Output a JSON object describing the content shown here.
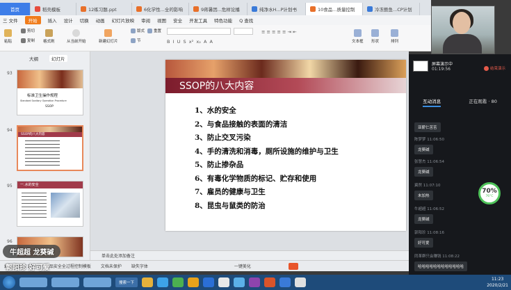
{
  "tabs": [
    {
      "label": "首页"
    },
    {
      "label": "稻壳模板"
    },
    {
      "label": "12练习题.ppt"
    },
    {
      "label": "6化学性...全的影响"
    },
    {
      "label": "9蒋暑因...危样论播"
    },
    {
      "label": "纯净水H...P计划书"
    },
    {
      "label": "10食品...质量控制"
    },
    {
      "label": "冷冻鲍鱼...CP计划"
    }
  ],
  "menu": {
    "file": "三 文件",
    "items": [
      "开始",
      "插入",
      "设计",
      "切换",
      "动画",
      "幻灯片放映",
      "审阅",
      "视图",
      "安全",
      "开发工具",
      "特色功能"
    ],
    "search": "Q 查找"
  },
  "ribbon": {
    "paste": "粘贴",
    "cut": "剪切",
    "copy": "复制",
    "format_painter": "格式刷",
    "from_current": "从当前开始",
    "new_slide": "新建幻灯片",
    "layout": "版式",
    "section": "节",
    "reset": "重置",
    "textbox": "文本框",
    "shape": "形状",
    "arrange": "排列"
  },
  "left_panel": {
    "tabs": [
      "大纲",
      "幻灯片"
    ],
    "thumbs": [
      {
        "num": "93",
        "title": "标准卫生操作规程",
        "subtitle": "Standard Sanitary Operation Procedure",
        "code": "SSOP"
      },
      {
        "num": "94",
        "title": "SSOP的八大内容"
      },
      {
        "num": "95",
        "title": "一.水的安全"
      },
      {
        "num": "96"
      }
    ]
  },
  "slide": {
    "title": "SSOP的八大内容",
    "items": [
      "1、水的安全",
      "2、与食品接触的表面的清洁",
      "3、防止交叉污染",
      "4、手的清洗和消毒，厕所设施的维护与卫生",
      "5、防止掺杂品",
      "6、有毒化学物质的标记、贮存和使用",
      "7、雇员的健康与卫生",
      "8、昆虫与鼠类的防治"
    ]
  },
  "notes_placeholder": "单击此处添加备注",
  "statusbar": {
    "slide_info": "幻灯片 94 / 144",
    "theme": "食品安全全过程控制模板",
    "backup": "文档未保护",
    "missing_font": "缺失字体",
    "beautify": "一键美化"
  },
  "live": {
    "status": "屏幕演示中",
    "elapsed": "01:19:56",
    "end_label": "结束演示",
    "tab_interact": "互动消息",
    "tab_watching": "正在观看 · 80",
    "messages": [
      {
        "name": "",
        "time": "",
        "text": "亚薪仁苦苦"
      },
      {
        "name": "陈梦梦",
        "time": "11:06:50",
        "text": "龙葵碱"
      },
      {
        "name": "张慧杰",
        "time": "11:06:54",
        "text": "龙葵碱"
      },
      {
        "name": "冀然",
        "time": "11:07:10",
        "text": "未加热"
      },
      {
        "name": "牛超超",
        "time": "11:06:52",
        "text": "龙葵碱"
      },
      {
        "name": "郭阳珍",
        "time": "11:08:16",
        "text": "好可爱"
      },
      {
        "name": "同革群只会赚钱",
        "time": "11:08:22",
        "text": "哈哈哈哈哈哈哈哈哈哈哈哈"
      }
    ],
    "gauge_value": "70%",
    "gauge_sub": "76°C",
    "gauge_fraction": 0.7
  },
  "overlay": {
    "line1_name": "牛超超",
    "line1_text": "龙葵碱",
    "line2_name": "郭阳珍",
    "line2_text": "好可爱"
  },
  "taskbar": {
    "button": "搜索一下",
    "time": "11:23",
    "date": "2020/2/21"
  }
}
